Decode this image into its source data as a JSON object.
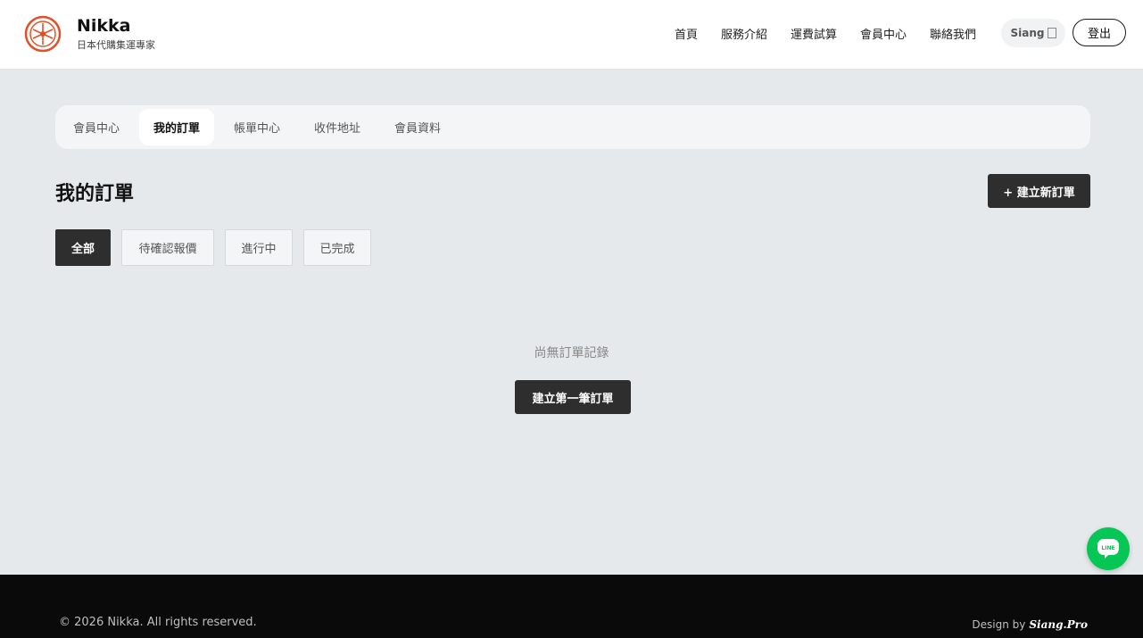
{
  "brand": {
    "name": "Nikka",
    "tagline": "日本代購集運專家",
    "accent": "#e2502a"
  },
  "nav": {
    "items": [
      {
        "label": "首頁",
        "icon": ""
      },
      {
        "label": "服務介紹"
      },
      {
        "label": "運費試算"
      },
      {
        "label": "會員中心"
      },
      {
        "label": "聯絡我們"
      }
    ],
    "user": {
      "name": "Siang",
      "icon": "user-icon"
    },
    "logout": "登出"
  },
  "tabs": [
    {
      "label": "會員中心",
      "active": false
    },
    {
      "label": "我的訂單",
      "active": true
    },
    {
      "label": "帳單中心",
      "active": false
    },
    {
      "label": "收件地址",
      "active": false
    },
    {
      "label": "會員資料",
      "active": false
    }
  ],
  "page": {
    "title": "我的訂單",
    "new_order": "+ 建立新訂單",
    "filters": [
      {
        "label": "全部",
        "active": true
      },
      {
        "label": "待確認報價",
        "active": false
      },
      {
        "label": "進行中",
        "active": false
      },
      {
        "label": "已完成",
        "active": false
      }
    ],
    "empty_text": "尚無訂單記錄",
    "first_order": "建立第一筆訂單"
  },
  "floating": {
    "icon": "line-chat-icon",
    "color": "#06c755"
  },
  "footer": {
    "copyright": "© 2026 Nikka. All rights reserved.",
    "design_prefix": "Design by",
    "designer": "Siang.Pro"
  }
}
